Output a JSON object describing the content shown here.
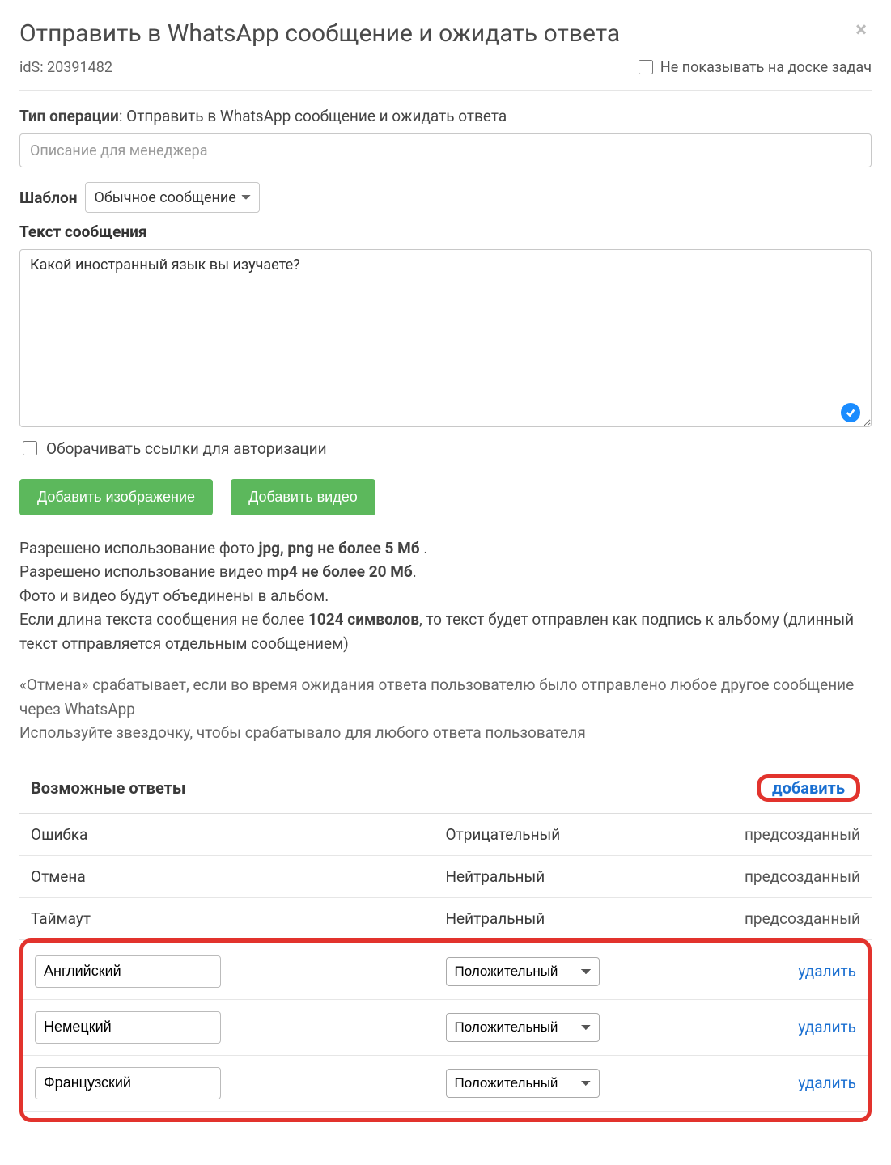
{
  "header": {
    "title": "Отправить в WhatsApp сообщение и ожидать ответа",
    "ids_label": "idS: 20391482",
    "hide_checkbox_label": "Не показывать на доске задач"
  },
  "operation": {
    "label": "Тип операции",
    "value": "Отправить в WhatsApp сообщение и ожидать ответа",
    "description_placeholder": "Описание для менеджера"
  },
  "template": {
    "label": "Шаблон",
    "selected": "Обычное сообщение"
  },
  "message": {
    "label": "Текст сообщения",
    "text": "Какой иностранный язык вы изучаете?",
    "wrap_links_label": "Оборачивать ссылки для авторизации"
  },
  "buttons": {
    "add_image": "Добавить изображение",
    "add_video": "Добавить видео"
  },
  "info": {
    "photo_prefix": "Разрешено использование фото ",
    "photo_bold": "jpg, png не более 5 Мб",
    "photo_suffix": " .",
    "video_prefix": "Разрешено использование видео ",
    "video_bold": "mp4 не более 20 Мб",
    "video_suffix": ".",
    "album_line": "Фото и видео будут объединены в альбом.",
    "len_prefix": "Если длина текста сообщения не более ",
    "len_bold": "1024 символов",
    "len_suffix": ", то текст будет отправлен как подпись к альбому (длинный текст отправляется отдельным сообщением)",
    "cancel_note": "«Отмена» срабатывает, если во время ожидания ответа пользователю было отправлено любое другое сообщение через WhatsApp",
    "star_note": "Используйте звездочку, чтобы срабатывало для любого ответа пользователя"
  },
  "answers": {
    "title": "Возможные ответы",
    "add_label": "добавить",
    "delete_label": "удалить",
    "preset_label": "предсозданный",
    "preset_rows": [
      {
        "name": "Ошибка",
        "type": "Отрицательный"
      },
      {
        "name": "Отмена",
        "type": "Нейтральный"
      },
      {
        "name": "Таймаут",
        "type": "Нейтральный"
      }
    ],
    "editable_rows": [
      {
        "name": "Английский",
        "type": "Положительный"
      },
      {
        "name": "Немецкий",
        "type": "Положительный"
      },
      {
        "name": "Французский",
        "type": "Положительный"
      }
    ]
  }
}
